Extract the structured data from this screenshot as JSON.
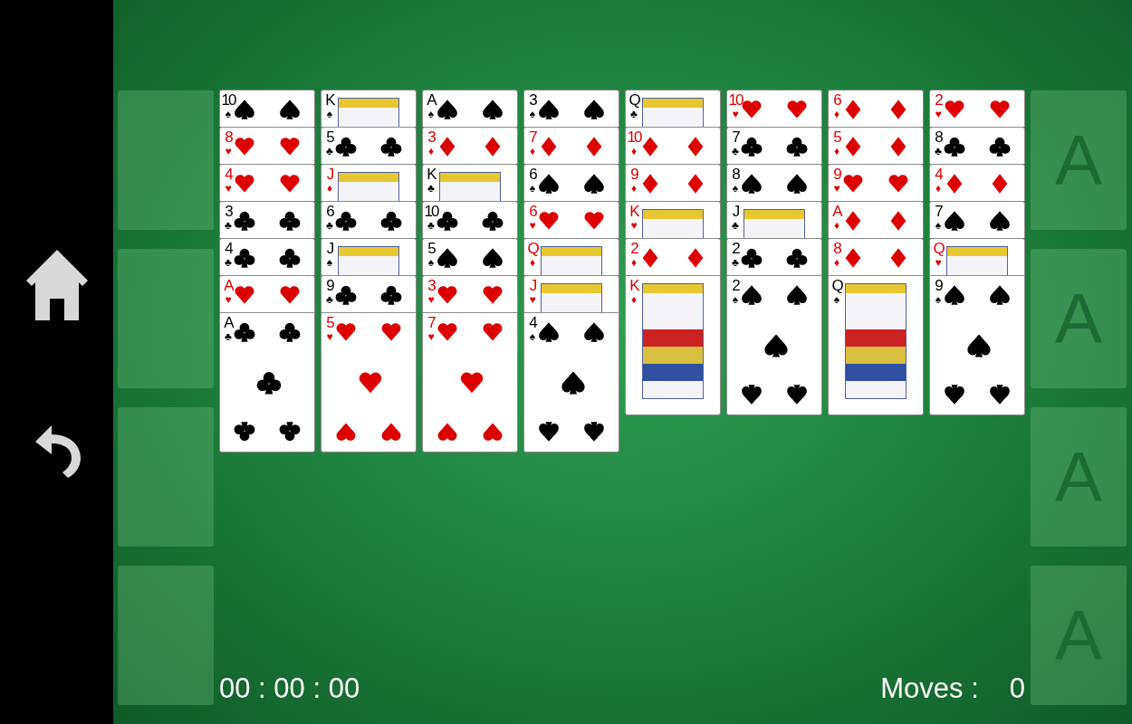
{
  "sidebar": {
    "buttons": [
      {
        "kind": "home"
      },
      {
        "kind": "undo"
      }
    ]
  },
  "tableau": [
    [
      {
        "rank": "10",
        "suit": "♠",
        "face": false,
        "kind": "spade"
      },
      {
        "rank": "8",
        "suit": "♥",
        "face": false,
        "kind": "heart"
      },
      {
        "rank": "4",
        "suit": "♥",
        "face": false,
        "kind": "heart"
      },
      {
        "rank": "3",
        "suit": "♣",
        "face": false,
        "kind": "club"
      },
      {
        "rank": "4",
        "suit": "♣",
        "face": false,
        "kind": "club"
      },
      {
        "rank": "A",
        "suit": "♥",
        "face": false,
        "kind": "heart"
      },
      {
        "rank": "A",
        "suit": "♣",
        "face": false,
        "kind": "club"
      }
    ],
    [
      {
        "rank": "K",
        "suit": "♠",
        "face": true,
        "kind": "spade"
      },
      {
        "rank": "5",
        "suit": "♣",
        "face": false,
        "kind": "club"
      },
      {
        "rank": "J",
        "suit": "♦",
        "face": true,
        "kind": "diamond"
      },
      {
        "rank": "6",
        "suit": "♣",
        "face": false,
        "kind": "club"
      },
      {
        "rank": "J",
        "suit": "♠",
        "face": true,
        "kind": "spade"
      },
      {
        "rank": "9",
        "suit": "♣",
        "face": false,
        "kind": "club"
      },
      {
        "rank": "5",
        "suit": "♥",
        "face": false,
        "kind": "heart"
      }
    ],
    [
      {
        "rank": "A",
        "suit": "♠",
        "face": false,
        "kind": "spade"
      },
      {
        "rank": "3",
        "suit": "♦",
        "face": false,
        "kind": "diamond"
      },
      {
        "rank": "K",
        "suit": "♣",
        "face": true,
        "kind": "club"
      },
      {
        "rank": "10",
        "suit": "♣",
        "face": false,
        "kind": "club"
      },
      {
        "rank": "5",
        "suit": "♠",
        "face": false,
        "kind": "spade"
      },
      {
        "rank": "3",
        "suit": "♥",
        "face": false,
        "kind": "heart"
      },
      {
        "rank": "7",
        "suit": "♥",
        "face": false,
        "kind": "heart"
      }
    ],
    [
      {
        "rank": "3",
        "suit": "♠",
        "face": false,
        "kind": "spade"
      },
      {
        "rank": "7",
        "suit": "♦",
        "face": false,
        "kind": "diamond"
      },
      {
        "rank": "6",
        "suit": "♠",
        "face": false,
        "kind": "spade"
      },
      {
        "rank": "6",
        "suit": "♥",
        "face": false,
        "kind": "heart"
      },
      {
        "rank": "Q",
        "suit": "♦",
        "face": true,
        "kind": "diamond"
      },
      {
        "rank": "J",
        "suit": "♥",
        "face": true,
        "kind": "heart"
      },
      {
        "rank": "4",
        "suit": "♠",
        "face": false,
        "kind": "spade"
      }
    ],
    [
      {
        "rank": "Q",
        "suit": "♣",
        "face": true,
        "kind": "club"
      },
      {
        "rank": "10",
        "suit": "♦",
        "face": false,
        "kind": "diamond"
      },
      {
        "rank": "9",
        "suit": "♦",
        "face": false,
        "kind": "diamond"
      },
      {
        "rank": "K",
        "suit": "♥",
        "face": true,
        "kind": "heart"
      },
      {
        "rank": "2",
        "suit": "♦",
        "face": false,
        "kind": "diamond"
      },
      {
        "rank": "K",
        "suit": "♦",
        "face": true,
        "kind": "diamond"
      }
    ],
    [
      {
        "rank": "10",
        "suit": "♥",
        "face": false,
        "kind": "heart"
      },
      {
        "rank": "7",
        "suit": "♣",
        "face": false,
        "kind": "club"
      },
      {
        "rank": "8",
        "suit": "♠",
        "face": false,
        "kind": "spade"
      },
      {
        "rank": "J",
        "suit": "♣",
        "face": true,
        "kind": "club"
      },
      {
        "rank": "2",
        "suit": "♣",
        "face": false,
        "kind": "club"
      },
      {
        "rank": "2",
        "suit": "♠",
        "face": false,
        "kind": "spade"
      }
    ],
    [
      {
        "rank": "6",
        "suit": "♦",
        "face": false,
        "kind": "diamond"
      },
      {
        "rank": "5",
        "suit": "♦",
        "face": false,
        "kind": "diamond"
      },
      {
        "rank": "9",
        "suit": "♥",
        "face": false,
        "kind": "heart"
      },
      {
        "rank": "A",
        "suit": "♦",
        "face": false,
        "kind": "diamond"
      },
      {
        "rank": "8",
        "suit": "♦",
        "face": false,
        "kind": "diamond"
      },
      {
        "rank": "Q",
        "suit": "♠",
        "face": true,
        "kind": "spade"
      }
    ],
    [
      {
        "rank": "2",
        "suit": "♥",
        "face": false,
        "kind": "heart"
      },
      {
        "rank": "8",
        "suit": "♣",
        "face": false,
        "kind": "club"
      },
      {
        "rank": "4",
        "suit": "♦",
        "face": false,
        "kind": "diamond"
      },
      {
        "rank": "7",
        "suit": "♠",
        "face": false,
        "kind": "spade"
      },
      {
        "rank": "Q",
        "suit": "♥",
        "face": true,
        "kind": "heart"
      },
      {
        "rank": "9",
        "suit": "♠",
        "face": false,
        "kind": "spade"
      }
    ]
  ],
  "foundations": [
    {
      "label": "A"
    },
    {
      "label": "A"
    },
    {
      "label": "A"
    },
    {
      "label": "A"
    }
  ],
  "timer": "00 : 00 : 00",
  "moves": {
    "label": "Moves :",
    "value": "0"
  }
}
